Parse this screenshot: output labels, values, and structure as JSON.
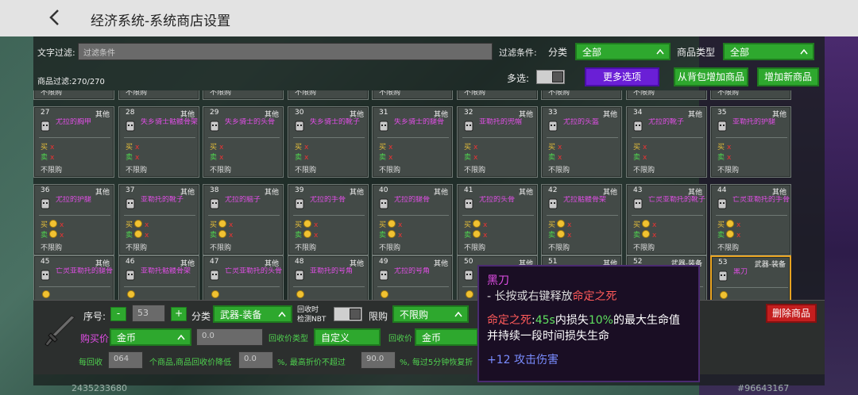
{
  "title": "经济系统-系统商店设置",
  "filter": {
    "text_label": "文字过滤:",
    "text_placeholder": "过滤条件",
    "cond_label": "过滤条件:",
    "cat_label": "分类",
    "cat_value": "全部",
    "type_label": "商品类型",
    "type_value": "全部",
    "count_label": "商品过滤:270/270",
    "multi_label": "多选:",
    "more_btn": "更多选项",
    "add_bag_btn": "从背包增加商品",
    "add_new_btn": "增加新商品"
  },
  "row0_limits": [
    "不限购",
    "不限购",
    "不限购",
    "不限购",
    "不限购",
    "不限购",
    "不限购",
    "不限购",
    "不限购"
  ],
  "rows": [
    [
      {
        "id": "27",
        "cat": "其他",
        "name": "尤拉的胸甲",
        "buy": "x",
        "sell": "x",
        "limit": "不限购",
        "coin": false
      },
      {
        "id": "28",
        "cat": "其他",
        "name": "失乡骑士骷髅骨架",
        "buy": "x",
        "sell": "x",
        "limit": "不限购",
        "coin": false
      },
      {
        "id": "29",
        "cat": "其他",
        "name": "失乡骑士的头骨",
        "buy": "x",
        "sell": "x",
        "limit": "不限购",
        "coin": false
      },
      {
        "id": "30",
        "cat": "其他",
        "name": "失乡骑士的靴子",
        "buy": "x",
        "sell": "x",
        "limit": "不限购",
        "coin": false
      },
      {
        "id": "31",
        "cat": "其他",
        "name": "失乡骑士的腿骨",
        "buy": "x",
        "sell": "x",
        "limit": "不限购",
        "coin": false
      },
      {
        "id": "32",
        "cat": "其他",
        "name": "亚勒托的兜帽",
        "buy": "x",
        "sell": "x",
        "limit": "不限购",
        "coin": false
      },
      {
        "id": "33",
        "cat": "其他",
        "name": "尤拉的头盔",
        "buy": "x",
        "sell": "x",
        "limit": "不限购",
        "coin": false
      },
      {
        "id": "34",
        "cat": "其他",
        "name": "尤拉的靴子",
        "buy": "x",
        "sell": "x",
        "limit": "不限购",
        "coin": false
      },
      {
        "id": "35",
        "cat": "其他",
        "name": "亚勒托的护腿",
        "buy": "x",
        "sell": "x",
        "limit": "不限购",
        "coin": false
      }
    ],
    [
      {
        "id": "36",
        "cat": "其他",
        "name": "尤拉的护腿",
        "buy": "x",
        "sell": "x",
        "limit": "不限购",
        "coin": true
      },
      {
        "id": "37",
        "cat": "其他",
        "name": "亚勒托的靴子",
        "buy": "x",
        "sell": "x",
        "limit": "不限购",
        "coin": true
      },
      {
        "id": "38",
        "cat": "其他",
        "name": "尤拉的脑子",
        "buy": "x",
        "sell": "x",
        "limit": "不限购",
        "coin": true
      },
      {
        "id": "39",
        "cat": "其他",
        "name": "尤拉的手骨",
        "buy": "x",
        "sell": "x",
        "limit": "不限购",
        "coin": true
      },
      {
        "id": "40",
        "cat": "其他",
        "name": "尤拉的腿骨",
        "buy": "x",
        "sell": "x",
        "limit": "不限购",
        "coin": true
      },
      {
        "id": "41",
        "cat": "其他",
        "name": "尤拉的头骨",
        "buy": "x",
        "sell": "x",
        "limit": "不限购",
        "coin": true
      },
      {
        "id": "42",
        "cat": "其他",
        "name": "尤拉骷髅骨架",
        "buy": "x",
        "sell": "x",
        "limit": "不限购",
        "coin": true
      },
      {
        "id": "43",
        "cat": "其他",
        "name": "亡灵亚勒托的靴子",
        "buy": "x",
        "sell": "x",
        "limit": "不限购",
        "coin": true
      },
      {
        "id": "44",
        "cat": "其他",
        "name": "亡灵亚勒托的手骨",
        "buy": "x",
        "sell": "x",
        "limit": "不限购",
        "coin": true
      }
    ],
    [
      {
        "id": "45",
        "cat": "其他",
        "name": "亡灵亚勒托的腿骨",
        "coin": true
      },
      {
        "id": "46",
        "cat": "其他",
        "name": "亚勒托骷髅骨架",
        "coin": true
      },
      {
        "id": "47",
        "cat": "其他",
        "name": "亡灵亚勒托的头骨",
        "coin": true
      },
      {
        "id": "48",
        "cat": "其他",
        "name": "亚勒托的号角",
        "coin": true
      },
      {
        "id": "49",
        "cat": "其他",
        "name": "尤拉的号角",
        "coin": true
      },
      {
        "id": "50",
        "cat": "其他",
        "name": "",
        "coin": true
      },
      {
        "id": "51",
        "cat": "其他",
        "name": "",
        "coin": true
      },
      {
        "id": "52",
        "cat": "武器-装备",
        "name": "",
        "coin": true
      },
      {
        "id": "53",
        "cat": "武器-装备",
        "name": "黑刀",
        "coin": true
      }
    ]
  ],
  "labels": {
    "buy": "买",
    "sell": "卖"
  },
  "bottom": {
    "seq_label": "序号:",
    "seq_minus": "-",
    "seq_value": "53",
    "seq_plus": "+",
    "cat_label": "分类",
    "cat_value": "武器-装备",
    "recycle_nbt_line1": "回收时",
    "recycle_nbt_line2": "检测NBT",
    "limit_label": "限购",
    "limit_value": "不限购",
    "buy_price_label": "购买价",
    "buy_currency": "金币",
    "buy_amount": "0.0",
    "recycle_type_label": "回收价类型",
    "recycle_type_value": "自定义",
    "recycle_price_label": "回收价",
    "recycle_currency": "金币",
    "delete_btn": "删除商品",
    "per_recycle_label": "每回收",
    "per_recycle_value": "064",
    "per_recycle_text": "个商品,商品回收价降低",
    "reduce_value": "0.0",
    "max_text": "%, 最高折价不超过",
    "max_value": "90.0",
    "tail_text": "%, 每过5分钟恢复折"
  },
  "tooltip": {
    "name": "黑刀",
    "desc_prefix": "- 长按或右键释放",
    "desc_skill": "命定之死",
    "skill_name": "命定之死",
    "skill_colon": ":",
    "skill_time": "45s",
    "skill_text1": "内损失",
    "skill_pct": "10%",
    "skill_text2": "的最大生命值",
    "skill_line2": "并持续一段时间损失生命",
    "stat_val": "+12",
    "stat_name": "攻击伤害"
  },
  "footer": {
    "left_id": "2435233680",
    "right_id": "#96643167"
  },
  "colors": {
    "accent_green": "#2ea82e",
    "accent_purple": "#6a1fd6",
    "delete_red": "#c41e1e",
    "item_name": "#e14ee6",
    "selected_border": "#e8a320"
  }
}
